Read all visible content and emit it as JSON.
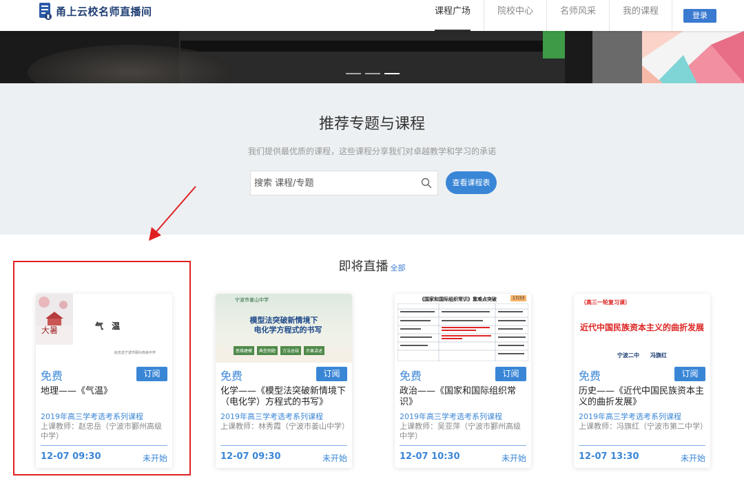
{
  "header": {
    "logo_text": "甬上云校名师直播间",
    "nav": [
      "课程广场",
      "院校中心",
      "名师风采",
      "我的课程"
    ],
    "login": "登录"
  },
  "recommend": {
    "title": "推荐专题与课程",
    "subtitle": "我们提供最优质的课程，这些课程分享我们对卓越教学和学习的承诺",
    "search_placeholder": "搜索 课程/专题",
    "schedule_button": "查看课程表"
  },
  "live": {
    "title": "即将直播",
    "all_link": "全部"
  },
  "cards": [
    {
      "cover": {
        "main": "气 温",
        "small": "赵忠岳宁波市鄞州高级中学",
        "side": "大暑"
      },
      "price": "免费",
      "subscribe": "订阅",
      "title": "地理——《气温》",
      "series": "2019年高三学考选考系列课程",
      "teacher": "上课教师：赵忠岳（宁波市鄞州高级中学）",
      "time": "12-07 09:30",
      "status": "未开始"
    },
    {
      "cover": {
        "school": "宁波市姜山中学",
        "line1": "模型法突破新情境下",
        "line2": "电化学方程式的书写",
        "tags": [
          "思维建模",
          "典型例题",
          "方法总结",
          "许果讲述"
        ]
      },
      "price": "免费",
      "subscribe": "订阅",
      "title": "化学——《模型法突破新情境下（电化学）方程式的书写》",
      "series": "2019年高三学考选考系列课程",
      "teacher": "上课教师：林秀霞（宁波市姜山中学）",
      "time": "12-07 09:30",
      "status": "未开始"
    },
    {
      "cover": {
        "heading": "《国家和国际组织常识》重难点突破",
        "page": "17/33"
      },
      "price": "免费",
      "subscribe": "订阅",
      "title": "政治——《国家和国际组织常识》",
      "series": "2019年高三学考选考系列课程",
      "teacher": "上课教师：吴亚萍（宁波市鄞州高级中学）",
      "time": "12-07 10:30",
      "status": "未开始"
    },
    {
      "cover": {
        "tag": "（高三一轮复习课）",
        "title": "近代中国民族资本主义的曲折发展",
        "author": "宁波二中　　冯旗红"
      },
      "price": "免费",
      "subscribe": "订阅",
      "title": "历史——《近代中国民族资本主义的曲折发展》",
      "series": "2019年高三学考选考系列课程",
      "teacher": "上课教师：冯旗红（宁波市第二中学）",
      "time": "12-07 13:30",
      "status": "未开始"
    }
  ]
}
